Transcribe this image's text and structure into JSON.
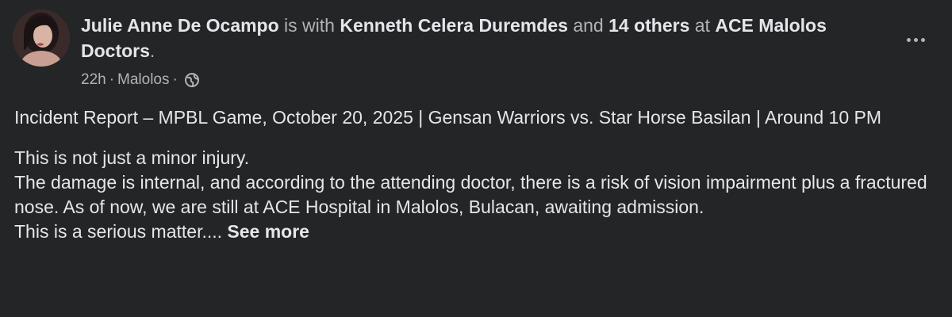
{
  "post": {
    "author": "Julie Anne De Ocampo",
    "is_with_text": " is with ",
    "tagged_person": "Kenneth Celera Duremdes",
    "and_text": " and ",
    "others": "14 others",
    "at_text": " at ",
    "location": "ACE Malolos Doctors",
    "period": ".",
    "time": "22h",
    "place": "Malolos",
    "sep": "·",
    "privacy_icon": "globe-icon",
    "more_icon": "more-options-icon",
    "title_line": "Incident Report – MPBL Game, October 20, 2025 | Gensan Warriors vs. Star Horse Basilan | Around 10 PM",
    "line1": "This is not just a minor injury.",
    "line2": "The damage is internal, and according to the attending doctor, there is a risk of vision impairment plus a fractured nose. As of now, we are still at ACE Hospital in Malolos, Bulacan, awaiting admission.",
    "line3": "This is a serious matter.... ",
    "see_more": "See more"
  },
  "colors": {
    "background": "#242526",
    "primary_text": "#e4e6eb",
    "secondary_text": "#b0b3b8"
  }
}
